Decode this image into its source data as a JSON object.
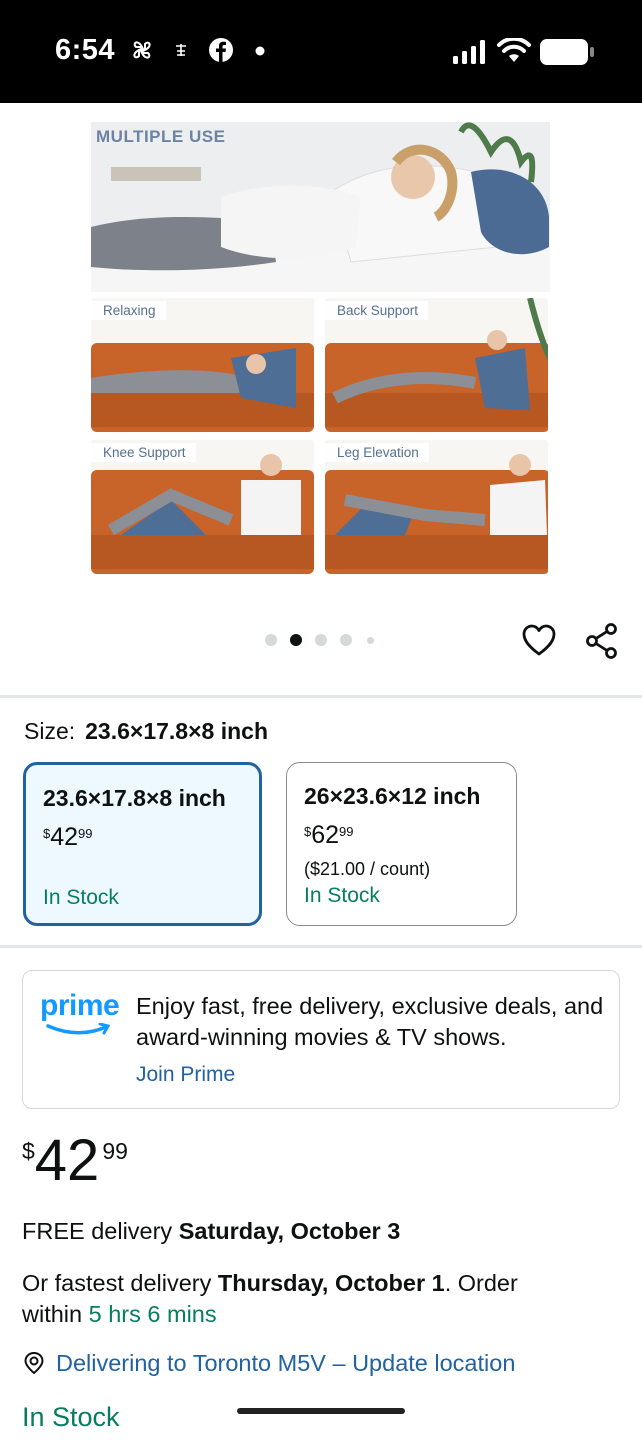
{
  "status_bar": {
    "time": "6:54"
  },
  "gallery": {
    "hero_label": "MULTIPLE USE",
    "tiles": [
      "Relaxing",
      "Back Support",
      "Knee Support",
      "Leg Elevation"
    ],
    "dots_total": 5,
    "dots_active": 2
  },
  "size": {
    "label": "Size:",
    "selected": "23.6×17.8×8 inch",
    "options": [
      {
        "title": "23.6×17.8×8 inch",
        "currency": "$",
        "whole": "42",
        "fraction": "99",
        "unit_price": "",
        "stock": "In Stock",
        "selected": true
      },
      {
        "title": "26×23.6×12 inch",
        "currency": "$",
        "whole": "62",
        "fraction": "99",
        "unit_price": "($21.00 / count)",
        "stock": "In Stock",
        "selected": false
      }
    ]
  },
  "prime": {
    "logo": "prime",
    "text": "Enjoy fast, free delivery, exclusive deals, and award-winning movies & TV shows.",
    "join": "Join Prime"
  },
  "price": {
    "currency": "$",
    "whole": "42",
    "fraction": "99"
  },
  "delivery": {
    "free_prefix": "FREE delivery ",
    "free_date": "Saturday, October 3",
    "fastest_prefix": "Or fastest delivery ",
    "fastest_date": "Thursday, October 1",
    "order_within": ". Order within ",
    "countdown": "5 hrs 6 mins",
    "location": "Delivering to Toronto M5V – Update location"
  },
  "stock": "In Stock",
  "colors": {
    "accent_blue": "#2162a1",
    "green": "#067d62",
    "prime_blue": "#1399ff"
  }
}
